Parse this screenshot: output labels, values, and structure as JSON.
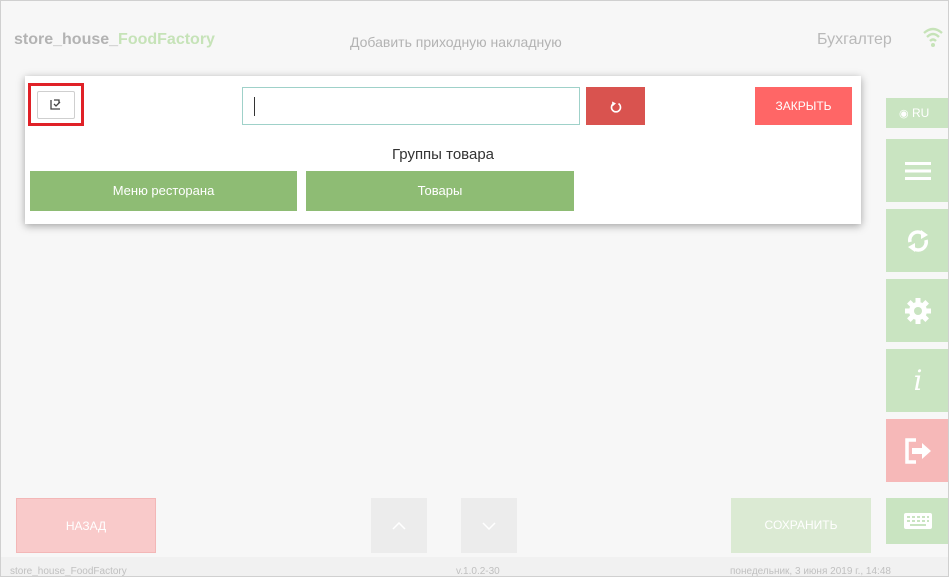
{
  "header": {
    "app_name_main": "store_house_",
    "app_name_accent": "FoodFactory",
    "page_title": "Добавить приходную накладную",
    "user_name": "Бухгалтер",
    "wifi_icon": "wifi-icon"
  },
  "sidebar": {
    "lang_label": "RU",
    "items": [
      {
        "name": "menu",
        "icon": "hamburger-icon"
      },
      {
        "name": "refresh",
        "icon": "sync-icon"
      },
      {
        "name": "settings",
        "icon": "gear-icon"
      },
      {
        "name": "info",
        "icon": "info-icon"
      },
      {
        "name": "logout",
        "icon": "logout-icon",
        "color": "#f6b8b8"
      }
    ],
    "keyboard_icon": "keyboard-icon"
  },
  "bottom": {
    "back_label": "НАЗАД",
    "save_label": "СОХРАНИТЬ"
  },
  "footer": {
    "app": "store_house_FoodFactory",
    "version": "v.1.0.2-30",
    "datetime": "понедельник, 3 июня 2019 г., 14:48"
  },
  "modal": {
    "search_value": "",
    "close_label": "ЗАКРЫТЬ",
    "groups_title": "Группы товара",
    "groups": [
      {
        "label": "Меню ресторана"
      },
      {
        "label": "Товары"
      }
    ]
  },
  "colors": {
    "accent_green": "#8ebc74",
    "close_red": "#ff6666",
    "reset_red": "#d9534f",
    "highlight_red": "#e02127"
  }
}
